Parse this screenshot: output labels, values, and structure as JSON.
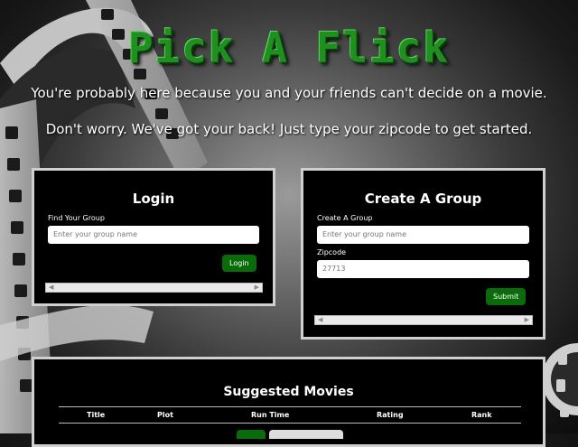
{
  "app": {
    "title": "Pick A Flick",
    "tagline_1": "You're probably here because you and your friends can't decide on a movie.",
    "tagline_2": "Don't worry. We've got your back! Just type your zipcode to get started."
  },
  "login": {
    "heading": "Login",
    "group_label": "Find Your Group",
    "group_placeholder": "Enter your group name",
    "button_label": "Login"
  },
  "create_group": {
    "heading": "Create A Group",
    "group_label": "Create A Group",
    "group_placeholder": "Enter your group name",
    "zip_label": "Zipcode",
    "zip_value": "27713",
    "button_label": "Submit"
  },
  "movies": {
    "heading": "Suggested Movies",
    "columns": [
      "Title",
      "Plot",
      "Run Time",
      "Rating",
      "Rank"
    ]
  },
  "colors": {
    "accent_green": "#0a6b0a",
    "title_green": "#1f8f1f",
    "card_bg": "#000000"
  }
}
